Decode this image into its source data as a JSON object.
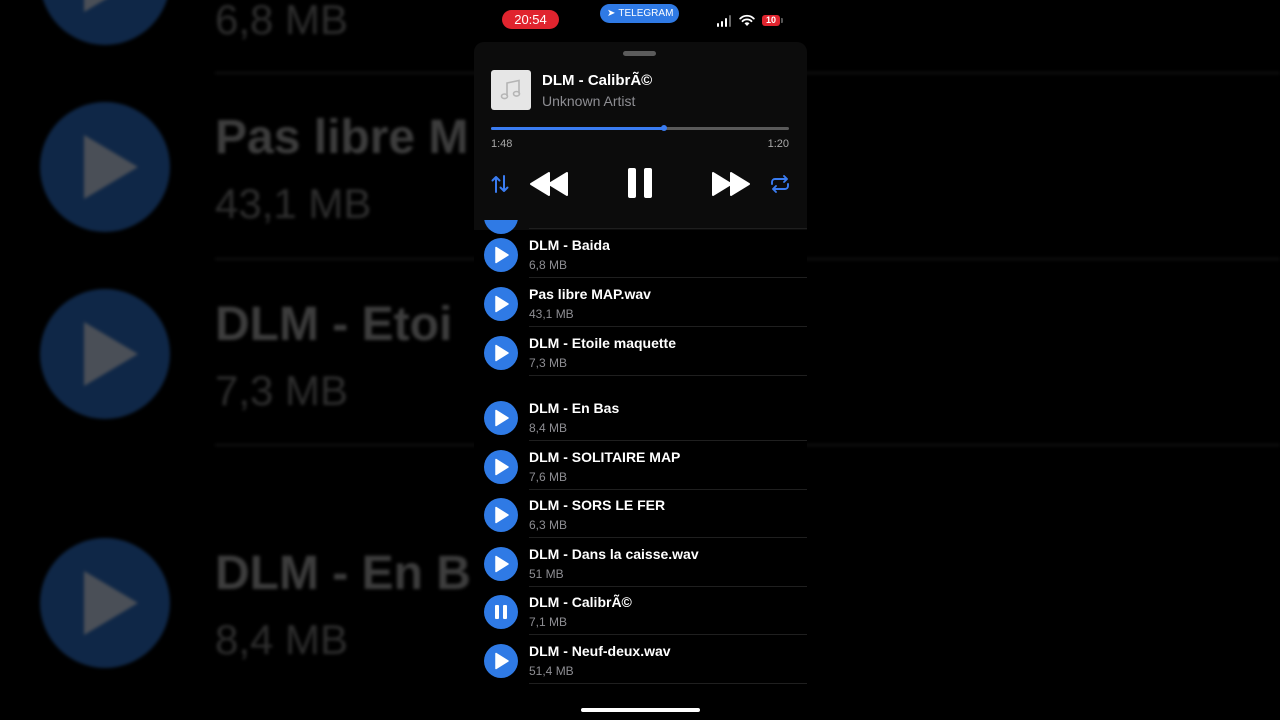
{
  "status_bar": {
    "time": "20:54",
    "app_pill": "TELEGRAM",
    "battery": "10",
    "colors": {
      "time_pill": "#e0242e",
      "app_pill": "#2f7ae5"
    }
  },
  "now_playing": {
    "title": "DLM - CalibrÃ©",
    "artist": "Unknown Artist",
    "elapsed": "1:48",
    "total": "1:20",
    "progress_fraction": 0.58,
    "controls": [
      "sort-icon",
      "rewind-icon",
      "pause-icon",
      "fast-forward-icon",
      "repeat-icon"
    ]
  },
  "tracks": [
    {
      "title": "DLM - Baida",
      "size": "6,8 MB",
      "state": "play"
    },
    {
      "title": "Pas libre MAP.wav",
      "size": "43,1 MB",
      "state": "play"
    },
    {
      "title": "DLM - Etoile maquette",
      "size": "7,3 MB",
      "state": "play"
    },
    {
      "title": "DLM - En Bas",
      "size": "8,4 MB",
      "state": "play"
    },
    {
      "title": "DLM - SOLITAIRE MAP",
      "size": "7,6 MB",
      "state": "play"
    },
    {
      "title": "DLM - SORS LE FER",
      "size": "6,3 MB",
      "state": "play"
    },
    {
      "title": "DLM - Dans la caisse.wav",
      "size": "51 MB",
      "state": "play"
    },
    {
      "title": "DLM - CalibrÃ©",
      "size": "7,1 MB",
      "state": "pause"
    },
    {
      "title": "DLM - Neuf-deux.wav",
      "size": "51,4 MB",
      "state": "play"
    }
  ],
  "background": {
    "titles": [
      "Pas libre M",
      "DLM - Etoi",
      "DLM - En B"
    ],
    "sizes": [
      "6,8 MB",
      "43,1 MB",
      "7,3 MB",
      "8,4 MB"
    ]
  },
  "accent_color": "#2f7ae5"
}
